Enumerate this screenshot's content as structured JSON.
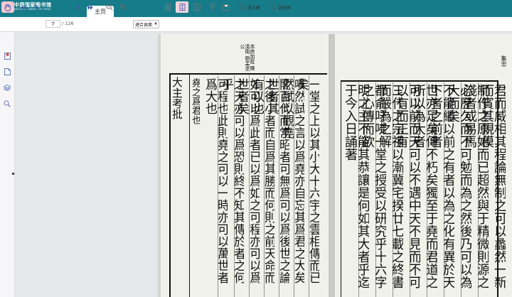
{
  "header": {
    "logo_cn": "中国国家图书馆",
    "logo_en": "NATIONAL LIBRARY OF CHINA",
    "home_tab": "主页",
    "bg_color": "#177c8a"
  },
  "toolbar": {
    "page_current": "7",
    "page_total": "/ 126",
    "zoom_value": "適合頁面",
    "magnifier_label": "放大鏡",
    "select_label": "选取框",
    "icons": [
      "hand-icon",
      "first-page-icon",
      "prev-page-icon",
      "next-page-icon",
      "last-page-icon",
      "zoom-out-icon",
      "zoom-in-icon",
      "single-page-icon",
      "fit-page-icon",
      "double-page-icon",
      "rotate-icon",
      "full-screen-icon",
      "magnifier-icon",
      "select-box-icon"
    ]
  },
  "sidebar": {
    "icons": [
      "bookmark-icon",
      "pages-icon",
      "layers-icon",
      "search-icon"
    ]
  },
  "book": {
    "left_page": {
      "side_header": "本房加批 陳清衛 劉孟塗 公",
      "columns": [
        "大主考批",
        "堯之爲君也",
        "可程也此則堯之可以一時亦可以萬世者爲大也",
        "之天亦可以爲恐則終不知其傳於者之何乎",
        "如可以爲此者已以爲如之可程亦可以爲世者矣",
        "之後小者而自爲其勝而何則之前天命而有以也",
        "閣百代而常昭者可無爲可以爲後世之論世者其",
        "嘆然試之言以爲堯亦自忘其爲君之大矣然試以觀堯",
        "一堂之上以其小大十六宇之雲相傳而已矣"
      ]
    },
    "right_page": {
      "columns": [
        "明之主不能其恭讓是何如其大者乎迄于今入日誦著",
        "都俞吁咈一堂之授受以研究乎十六字之心傳而欲",
        "三代之宗祖以漸冀宅揆廿七載之終書而嚴為之解",
        "可以前而天可以不遇中天不見而不可以有而正有",
        "世亦足矣傳不朽矣獨至于堯而君道之所以為大者",
        "不能繼以前之有者以為之化有異於天下者之前者",
        "必歷久而不可勉而為之然後乃可以為大而矣",
        "制作之原始而已超然與于精微則源之淺者或易馬",
        "君而威相其程論無制之可以蠡然一新而賓其規模"
      ],
      "margin_label": "集忠"
    }
  }
}
